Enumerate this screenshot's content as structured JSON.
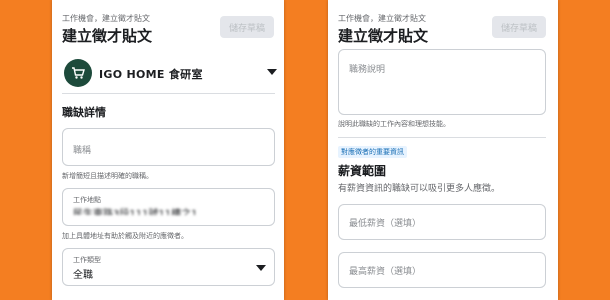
{
  "left_panel": {
    "breadcrumb": "工作機會，建立徵才貼文",
    "title": "建立徵才貼文",
    "save_label": "儲存草稿",
    "page_name": "IGO HOME 食研室",
    "section_title": "職缺詳情",
    "job_title_placeholder": "職稱",
    "job_title_helper": "新增簡短且描述明確的職稱。",
    "location_label": "工作地點",
    "location_value": "民生東路3段111號11樓之1",
    "location_helper": "加上具體地址有助於觸及附近的應徵者。",
    "job_type_label": "工作類型",
    "job_type_value": "全職"
  },
  "right_panel": {
    "breadcrumb": "工作機會，建立徵才貼文",
    "title": "建立徵才貼文",
    "save_label": "儲存草稿",
    "description_placeholder": "職務說明",
    "description_helper": "說明此職缺的工作內容和理想技能。",
    "highlight_tag": "對應徵者的重要資訊",
    "salary_title": "薪資範圍",
    "salary_desc": "有薪資資訊的職缺可以吸引更多人應徵。",
    "min_salary_placeholder": "最低薪資（選填）",
    "max_salary_placeholder": "最高薪資（選填）"
  },
  "colors": {
    "background": "#f47e21",
    "logo_bg": "#1d4a3b",
    "highlight_text": "#1a6fb5"
  }
}
